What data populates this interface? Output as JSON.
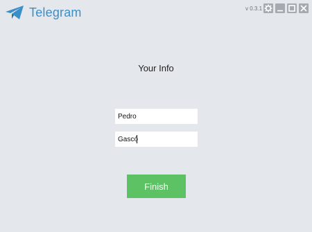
{
  "app": {
    "title": "Telegram",
    "version": "v 0.3.1"
  },
  "window_controls": [
    "settings-icon",
    "minimize-icon",
    "maximize-icon",
    "close-icon"
  ],
  "signup": {
    "heading": "Your Info",
    "first_name_value": "Pedro",
    "last_name_value": "Gascó",
    "finish_label": "Finish"
  },
  "colors": {
    "brand": "#3a8fc8",
    "background": "#e4e8ed",
    "finish_button": "#5dc264",
    "controls": "#a4aab0"
  }
}
